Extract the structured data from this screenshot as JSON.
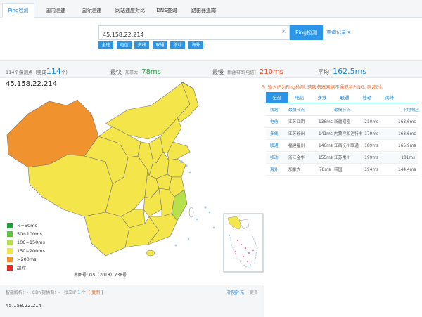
{
  "nav": {
    "tabs": [
      {
        "label": "Ping检测",
        "active": true
      },
      {
        "label": "国内测速",
        "active": false
      },
      {
        "label": "国际测速",
        "active": false
      },
      {
        "label": "网站速度对比",
        "active": false
      },
      {
        "label": "DNS查询",
        "active": false
      },
      {
        "label": "路由器追踪",
        "active": false
      }
    ]
  },
  "search": {
    "value": "45.158.22.214",
    "placeholder": "",
    "clear_icon": "×",
    "button": "Ping检测",
    "history": "查询记录 ▾",
    "filters": [
      "全选",
      "电信",
      "多线",
      "联通",
      "移动",
      "海外"
    ]
  },
  "summary": {
    "probe_prefix": "114个探测点（完成",
    "probe_done": "114",
    "probe_suffix": "个）",
    "fastest_label": "最快",
    "fastest_node": "加拿大",
    "fastest_value": "78ms",
    "slowest_label": "最慢",
    "slowest_node": "新疆昭密[电信]",
    "slowest_value": "210ms",
    "avg_label": "平均",
    "avg_value": "162.5ms"
  },
  "map": {
    "ip": "45.158.22.214",
    "approval": "审图号: GS（2018）738号",
    "legend": [
      {
        "label": "<=50ms",
        "color": "#1f9e3a"
      },
      {
        "label": "50~100ms",
        "color": "#5cc23f"
      },
      {
        "label": "100~150ms",
        "color": "#b8e04a"
      },
      {
        "label": "150~200ms",
        "color": "#f4e54a"
      },
      {
        "label": ">200ms",
        "color": "#f0922e"
      },
      {
        "label": "超时",
        "color": "#e02a25"
      }
    ]
  },
  "panel": {
    "notice_icon": "✎",
    "notice": "输入IP为Ping检测, 若服务器网络不通或禁PING, 则超时。",
    "tabs": [
      "全部",
      "电信",
      "多线",
      "联通",
      "移动",
      "海外"
    ],
    "headers": {
      "line": "线路",
      "fastest": "最快节点",
      "slowest": "最慢节点",
      "avg": "平均响应"
    },
    "rows": [
      {
        "line": "电信",
        "fnode": "江苏江阴",
        "fms": "136ms",
        "snode": "新疆昭密",
        "sms": "210ms",
        "avg": "163.6ms"
      },
      {
        "line": "多线",
        "fnode": "江苏徐州",
        "fms": "141ms",
        "snode": "内蒙呼和浩特市",
        "sms": "179ms",
        "avg": "163.6ms"
      },
      {
        "line": "联通",
        "fnode": "福建福州",
        "fms": "146ms",
        "snode": "江西抚州联通",
        "sms": "189ms",
        "avg": "165.9ms"
      },
      {
        "line": "移动",
        "fnode": "浙江金华",
        "fms": "155ms",
        "snode": "江苏常州",
        "sms": "199ms",
        "avg": "181ms"
      },
      {
        "line": "海外",
        "fnode": "加拿大",
        "fms": "78ms",
        "snode": "韩国",
        "sms": "194ms",
        "avg": "144.4ms"
      }
    ]
  },
  "bottom": {
    "smart_label": "智能解析：-",
    "cdn_label": "CDN提供商：-",
    "ip_count_prefix": "独立IP",
    "ip_count": "1",
    "ip_count_unit": "个",
    "detail": "[ 复制 ]",
    "bianchao": "补随补充",
    "more": "更多",
    "ip": "45.158.22.214"
  },
  "chart_data": {
    "type": "map",
    "title": "",
    "legend_bins": [
      "<=50ms",
      "50~100ms",
      "100~150ms",
      "150~200ms",
      ">200ms",
      "超时"
    ],
    "regions": [
      {
        "name": "新疆",
        "bin": ">200ms"
      },
      {
        "name": "西藏",
        "bin": "150~200ms"
      },
      {
        "name": "内蒙古",
        "bin": "150~200ms"
      },
      {
        "name": "青海",
        "bin": "150~200ms"
      },
      {
        "name": "甘肃",
        "bin": "150~200ms"
      },
      {
        "name": "四川",
        "bin": "150~200ms"
      },
      {
        "name": "云南",
        "bin": "150~200ms"
      },
      {
        "name": "广西",
        "bin": "150~200ms"
      },
      {
        "name": "贵州",
        "bin": "150~200ms"
      },
      {
        "name": "湖南",
        "bin": "150~200ms"
      },
      {
        "name": "湖北",
        "bin": "150~200ms"
      },
      {
        "name": "河南",
        "bin": "150~200ms"
      },
      {
        "name": "陕西",
        "bin": "150~200ms"
      },
      {
        "name": "山西",
        "bin": "150~200ms"
      },
      {
        "name": "河北",
        "bin": "150~200ms"
      },
      {
        "name": "山东",
        "bin": "150~200ms"
      },
      {
        "name": "江苏",
        "bin": "150~200ms"
      },
      {
        "name": "安徽",
        "bin": "150~200ms"
      },
      {
        "name": "江西",
        "bin": "150~200ms"
      },
      {
        "name": "广东",
        "bin": "150~200ms"
      },
      {
        "name": "黑龙江",
        "bin": "150~200ms"
      },
      {
        "name": "浙江",
        "bin": "150~200ms"
      },
      {
        "name": "福建",
        "bin": "100~150ms"
      }
    ]
  }
}
